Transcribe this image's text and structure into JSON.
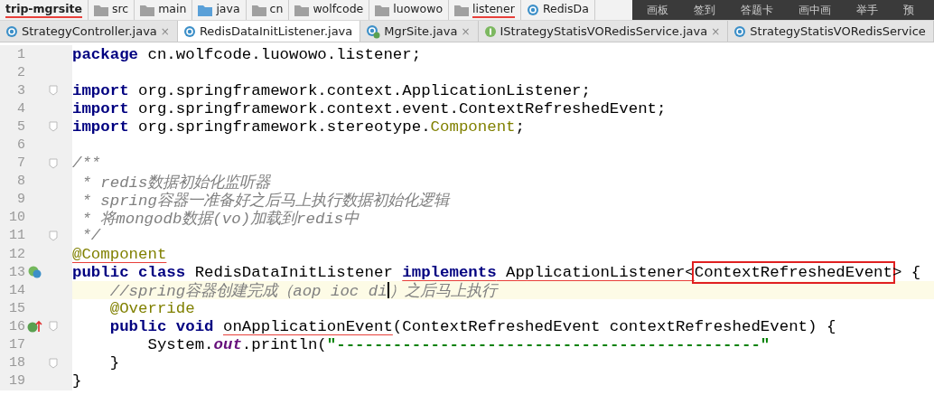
{
  "breadcrumb": [
    {
      "label": "trip-mgrsite",
      "kind": "project",
      "underlined": true
    },
    {
      "label": "src",
      "kind": "folder",
      "underlined": false
    },
    {
      "label": "main",
      "kind": "folder",
      "underlined": false
    },
    {
      "label": "java",
      "kind": "source",
      "underlined": false
    },
    {
      "label": "cn",
      "kind": "folder",
      "underlined": false
    },
    {
      "label": "wolfcode",
      "kind": "folder",
      "underlined": false
    },
    {
      "label": "luowowo",
      "kind": "folder",
      "underlined": false
    },
    {
      "label": "listener",
      "kind": "folder",
      "underlined": true
    },
    {
      "label": "RedisDa",
      "kind": "class",
      "underlined": false
    }
  ],
  "meeting_toolbar": [
    "画板",
    "签到",
    "答题卡",
    "画中画",
    "举手",
    "预"
  ],
  "tabs": [
    {
      "label": "StrategyController.java",
      "kind": "class",
      "selected": false,
      "close": "×"
    },
    {
      "label": "RedisDataInitListener.java",
      "kind": "class",
      "selected": true
    },
    {
      "label": "MgrSite.java",
      "kind": "app",
      "selected": false,
      "close": "×"
    },
    {
      "label": "IStrategyStatisVORedisService.java",
      "kind": "interface",
      "selected": false,
      "close": "×"
    },
    {
      "label": "StrategyStatisVORedisService",
      "kind": "class",
      "selected": false
    }
  ],
  "lines": [
    {
      "number": "1",
      "tokens": [
        {
          "kind": "kw",
          "text": "package"
        },
        {
          "kind": "txt",
          "text": " cn.wolfcode.luowowo.listener;"
        }
      ]
    },
    {
      "number": "2"
    },
    {
      "number": "3",
      "fold": true,
      "tokens": [
        {
          "kind": "kw",
          "text": "import"
        },
        {
          "kind": "txt",
          "text": " org.springframework.context.ApplicationListener;"
        }
      ]
    },
    {
      "number": "4",
      "tokens": [
        {
          "kind": "kw",
          "text": "import"
        },
        {
          "kind": "txt",
          "text": " org.springframework.context.event.ContextRefreshedEvent;"
        }
      ]
    },
    {
      "number": "5",
      "fold": true,
      "tokens": [
        {
          "kind": "kw",
          "text": "import"
        },
        {
          "kind": "txt",
          "text": " org.springframework.stereotype."
        },
        {
          "kind": "ann",
          "text": "Component"
        },
        {
          "kind": "txt",
          "text": ";"
        }
      ]
    },
    {
      "number": "6"
    },
    {
      "number": "7",
      "fold": true,
      "tokens": [
        {
          "kind": "cmt",
          "text": "/**"
        }
      ]
    },
    {
      "number": "8",
      "tokens": [
        {
          "kind": "cmt",
          "text": " * redis数据初始化监听器"
        }
      ]
    },
    {
      "number": "9",
      "tokens": [
        {
          "kind": "cmt",
          "text": " * spring容器一准备好之后马上执行数据初始化逻辑"
        }
      ]
    },
    {
      "number": "10",
      "tokens": [
        {
          "kind": "cmt",
          "text": " * 将mongodb数据(vo)加载到redis中"
        }
      ]
    },
    {
      "number": "11",
      "fold": true,
      "tokens": [
        {
          "kind": "cmt",
          "text": " */"
        }
      ]
    },
    {
      "number": "12",
      "tokens": [
        {
          "kind": "ann",
          "text": "@Component",
          "underlined": true
        }
      ]
    },
    {
      "number": "13",
      "gutter": {
        "kind": "class"
      },
      "tokens": [
        {
          "kind": "kw",
          "text": "public class"
        },
        {
          "kind": "txt",
          "text": " RedisDataInitListener "
        },
        {
          "kind": "kw",
          "text": "implements",
          "underlined": true
        },
        {
          "kind": "txt",
          "text": " ApplicationListener<",
          "underlined": true
        },
        {
          "kind": "txt",
          "text": "ContextRefreshedEvent",
          "boxed": true
        },
        {
          "kind": "txt",
          "text": "> {"
        }
      ]
    },
    {
      "number": "14",
      "current": true,
      "tokens": [
        {
          "kind": "cmt",
          "text": "    //spring容器创建完成（aop ioc di",
          "caret": true
        },
        {
          "kind": "cmt",
          "text": "）之后马上执行"
        }
      ]
    },
    {
      "number": "15",
      "tokens": [
        {
          "kind": "ann",
          "text": "    @Override"
        }
      ]
    },
    {
      "number": "16",
      "gutter": {
        "kind": "implements"
      },
      "fold": true,
      "tokens": [
        {
          "kind": "kw",
          "text": "    public void "
        },
        {
          "kind": "txt",
          "text": "onApplicationEvent",
          "underlined": true
        },
        {
          "kind": "txt",
          "text": "(ContextRefreshedEvent contextRefreshedEvent) {"
        }
      ]
    },
    {
      "number": "17",
      "tokens": [
        {
          "kind": "txt",
          "text": "        System."
        },
        {
          "kind": "fld",
          "text": "out"
        },
        {
          "kind": "txt",
          "text": ".println("
        },
        {
          "kind": "str",
          "text": "\"---------------------------------------------\""
        }
      ]
    },
    {
      "number": "18",
      "fold": true,
      "tokens": [
        {
          "kind": "txt",
          "text": "    }"
        }
      ]
    },
    {
      "number": "19",
      "tokens": [
        {
          "kind": "txt",
          "text": "}"
        }
      ]
    }
  ]
}
